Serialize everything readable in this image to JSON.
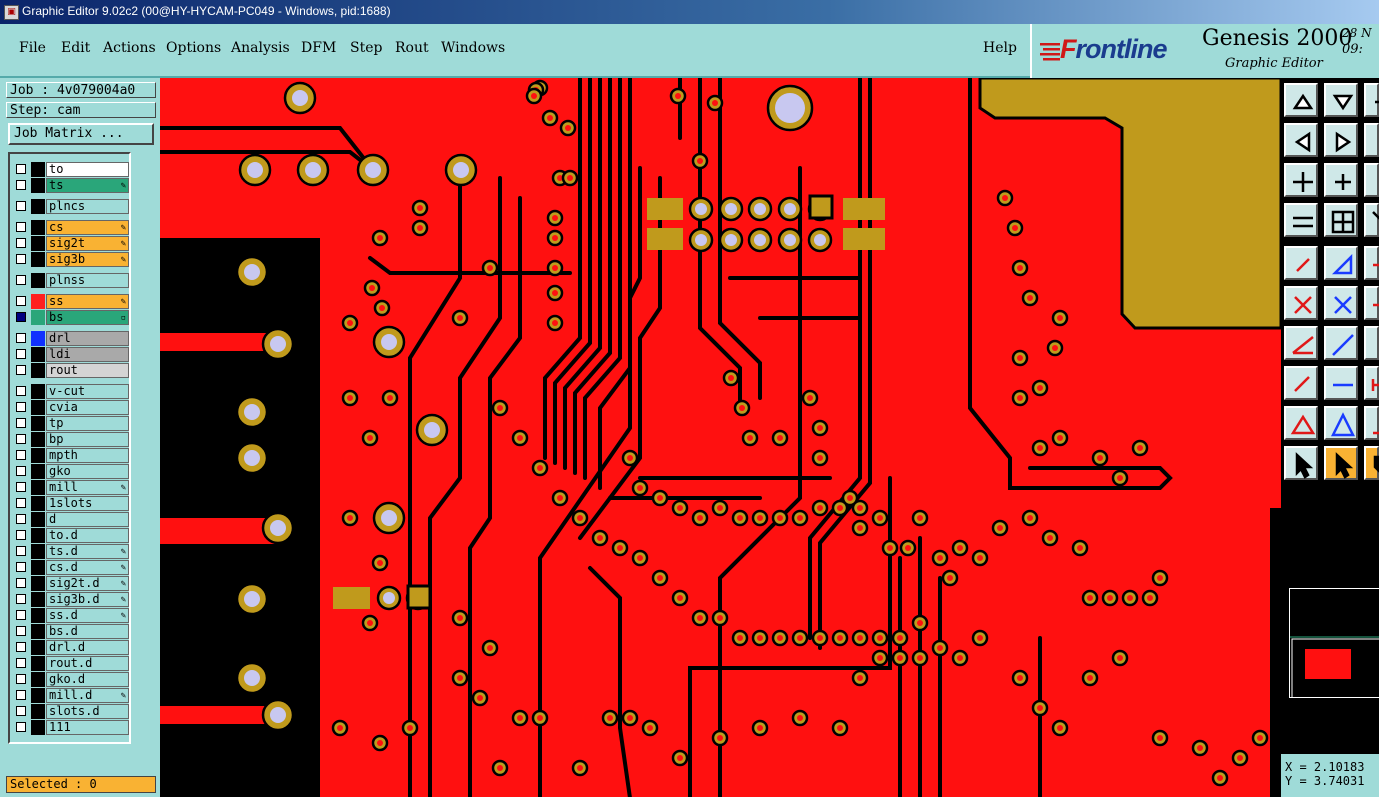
{
  "window": {
    "title": "Graphic Editor 9.02c2 (00@HY-HYCAM-PC049 - Windows, pid:1688)"
  },
  "menu": {
    "file": "File",
    "edit": "Edit",
    "actions": "Actions",
    "options": "Options",
    "analysis": "Analysis",
    "dfm": "DFM",
    "step": "Step",
    "rout": "Rout",
    "windows": "Windows",
    "help": "Help"
  },
  "brand": {
    "logo_prefix": "F",
    "logo_rest": "rontline",
    "product": "Genesis 2000",
    "subtitle": "Graphic Editor",
    "date_partial": "28 N",
    "time_partial": "09:"
  },
  "job": {
    "job_line": "Job : 4v079004a0",
    "step_line": "Step: cam",
    "matrix_button": "Job Matrix ..."
  },
  "layers": [
    {
      "name": "to",
      "bg": "#ffffff",
      "color": "#000000",
      "mark": "",
      "checked": false
    },
    {
      "name": "ts",
      "bg": "#2aa67a",
      "color": "#000000",
      "mark": "✎",
      "checked": false
    },
    {
      "name": "plncs",
      "bg": "#9fdbd8",
      "color": "#000000",
      "mark": "",
      "checked": false
    },
    {
      "name": "cs",
      "bg": "#f9b233",
      "color": "#000000",
      "mark": "✎",
      "checked": false
    },
    {
      "name": "sig2t",
      "bg": "#f9b233",
      "color": "#000000",
      "mark": "✎",
      "checked": false
    },
    {
      "name": "sig3b",
      "bg": "#f9b233",
      "color": "#000000",
      "mark": "✎",
      "checked": false
    },
    {
      "name": "plnss",
      "bg": "#9fdbd8",
      "color": "#000000",
      "mark": "",
      "checked": false
    },
    {
      "name": "ss",
      "bg": "#f9b233",
      "color": "#ff2020",
      "mark": "✎",
      "checked": false
    },
    {
      "name": "bs",
      "bg": "#2aa67a",
      "color": "#2aa67a",
      "mark": "▫",
      "checked": true
    },
    {
      "name": "drl",
      "bg": "#a9a9a9",
      "color": "#1030ff",
      "mark": "",
      "checked": false
    },
    {
      "name": "ldi",
      "bg": "#a9a9a9",
      "color": "#000000",
      "mark": "",
      "checked": false
    },
    {
      "name": "rout",
      "bg": "#d4d4d4",
      "color": "#000000",
      "mark": "",
      "checked": false
    },
    {
      "name": "v-cut",
      "bg": "#9fdbd8",
      "color": "#000000",
      "mark": "",
      "checked": false
    },
    {
      "name": "cvia",
      "bg": "#9fdbd8",
      "color": "#000000",
      "mark": "",
      "checked": false
    },
    {
      "name": "tp",
      "bg": "#9fdbd8",
      "color": "#000000",
      "mark": "",
      "checked": false
    },
    {
      "name": "bp",
      "bg": "#9fdbd8",
      "color": "#000000",
      "mark": "",
      "checked": false
    },
    {
      "name": "mpth",
      "bg": "#9fdbd8",
      "color": "#000000",
      "mark": "",
      "checked": false
    },
    {
      "name": "gko",
      "bg": "#9fdbd8",
      "color": "#000000",
      "mark": "",
      "checked": false
    },
    {
      "name": "mill",
      "bg": "#9fdbd8",
      "color": "#000000",
      "mark": "✎",
      "checked": false
    },
    {
      "name": "1slots",
      "bg": "#9fdbd8",
      "color": "#000000",
      "mark": "",
      "checked": false
    },
    {
      "name": "d",
      "bg": "#9fdbd8",
      "color": "#000000",
      "mark": "",
      "checked": false
    },
    {
      "name": "to.d",
      "bg": "#9fdbd8",
      "color": "#000000",
      "mark": "",
      "checked": false
    },
    {
      "name": "ts.d",
      "bg": "#9fdbd8",
      "color": "#000000",
      "mark": "✎",
      "checked": false
    },
    {
      "name": "cs.d",
      "bg": "#9fdbd8",
      "color": "#000000",
      "mark": "✎",
      "checked": false
    },
    {
      "name": "sig2t.d",
      "bg": "#9fdbd8",
      "color": "#000000",
      "mark": "✎",
      "checked": false
    },
    {
      "name": "sig3b.d",
      "bg": "#9fdbd8",
      "color": "#000000",
      "mark": "✎",
      "checked": false
    },
    {
      "name": "ss.d",
      "bg": "#9fdbd8",
      "color": "#000000",
      "mark": "✎",
      "checked": false
    },
    {
      "name": "bs.d",
      "bg": "#9fdbd8",
      "color": "#000000",
      "mark": "",
      "checked": false
    },
    {
      "name": "drl.d",
      "bg": "#9fdbd8",
      "color": "#000000",
      "mark": "",
      "checked": false
    },
    {
      "name": "rout.d",
      "bg": "#9fdbd8",
      "color": "#000000",
      "mark": "",
      "checked": false
    },
    {
      "name": "gko.d",
      "bg": "#9fdbd8",
      "color": "#000000",
      "mark": "",
      "checked": false
    },
    {
      "name": "mill.d",
      "bg": "#9fdbd8",
      "color": "#000000",
      "mark": "✎",
      "checked": false
    },
    {
      "name": "slots.d",
      "bg": "#9fdbd8",
      "color": "#000000",
      "mark": "",
      "checked": false
    },
    {
      "name": "111",
      "bg": "#9fdbd8",
      "color": "#000000",
      "mark": "",
      "checked": false
    }
  ],
  "status": {
    "selected": "Selected : 0"
  },
  "coords": {
    "x": "X = 2.10183",
    "y": "Y = 3.74031"
  },
  "colors": {
    "copper": "#ff1010",
    "pad": "#c09a1c",
    "drill": "#c8c8f0",
    "panel": "#9fdbd8",
    "highlight": "#f9b233"
  }
}
